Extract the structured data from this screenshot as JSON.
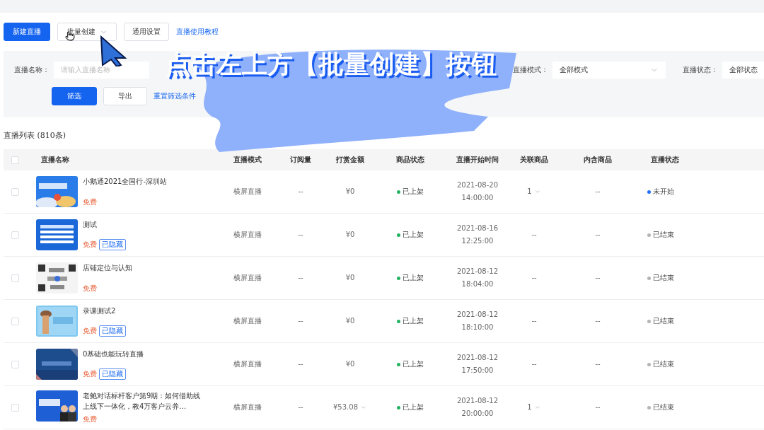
{
  "toolbar": {
    "buttons": [
      {
        "label": "新建直播",
        "kind": "primary"
      },
      {
        "label": "批量创建",
        "kind": "dropdown"
      },
      {
        "label": "通用设置",
        "kind": "default"
      }
    ],
    "link": "直播使用教程"
  },
  "filters": {
    "fields": [
      {
        "label": "直播名称：",
        "placeholder": "请输入直播名称",
        "kind": "input"
      },
      {
        "label": "直播模式：",
        "value": "全部模式",
        "kind": "select"
      },
      {
        "label": "直播状态：",
        "value": "全部状态",
        "kind": "select"
      }
    ],
    "buttons": [
      {
        "label": "筛选",
        "kind": "primary"
      },
      {
        "label": "导出",
        "kind": "default"
      }
    ],
    "reset_link": "重置筛选条件"
  },
  "caption": "点击左上方【批量创建】按钮",
  "list_title": "直播列表 (810条)",
  "table": {
    "select_all_checked": false,
    "columns": [
      "直播名称",
      "直播模式",
      "订阅量",
      "打赏金额",
      "商品状态",
      "直播开始时间",
      "关联商品",
      "内含商品",
      "直播状态"
    ],
    "rows": [
      {
        "checked": false,
        "title": "小鹅通2021全国行-深圳站",
        "price": "免费",
        "mode": "横屏直播",
        "subscribers": "--",
        "reward": "¥0",
        "reward_expandable": false,
        "goods_status": {
          "text": "已上架",
          "color": "#22b35e"
        },
        "date": "2021-08-20",
        "time": "14:00:00",
        "linked": "1",
        "linked_expandable": true,
        "contained": "--",
        "status": {
          "text": "未开始",
          "color": "#1f6fff"
        }
      },
      {
        "checked": false,
        "title": "测试",
        "price": "免费",
        "hidden_tag": "已隐藏",
        "mode": "横屏直播",
        "subscribers": "--",
        "reward": "¥0",
        "reward_expandable": false,
        "goods_status": {
          "text": "已上架",
          "color": "#22b35e"
        },
        "date": "2021-08-16",
        "time": "12:25:00",
        "linked": "--",
        "linked_expandable": false,
        "contained": "--",
        "status": {
          "text": "已结束",
          "color": "#b4b4b4"
        }
      },
      {
        "checked": false,
        "title": "店铺定位与认知",
        "price": "免费",
        "mode": "横屏直播",
        "subscribers": "--",
        "reward": "¥0",
        "reward_expandable": false,
        "goods_status": {
          "text": "已上架",
          "color": "#22b35e"
        },
        "date": "2021-08-12",
        "time": "18:04:00",
        "linked": "--",
        "linked_expandable": false,
        "contained": "--",
        "status": {
          "text": "已结束",
          "color": "#b4b4b4"
        }
      },
      {
        "checked": false,
        "title": "录课测试2",
        "price": "免费",
        "hidden_tag": "已隐藏",
        "mode": "横屏直播",
        "subscribers": "--",
        "reward": "¥0",
        "reward_expandable": false,
        "goods_status": {
          "text": "已上架",
          "color": "#22b35e"
        },
        "date": "2021-08-12",
        "time": "18:10:00",
        "linked": "--",
        "linked_expandable": false,
        "contained": "--",
        "status": {
          "text": "已结束",
          "color": "#b4b4b4"
        }
      },
      {
        "checked": false,
        "title": "0基础也能玩转直播",
        "price": "免费",
        "hidden_tag": "已隐藏",
        "mode": "横屏直播",
        "subscribers": "--",
        "reward": "¥0",
        "reward_expandable": false,
        "goods_status": {
          "text": "已上架",
          "color": "#22b35e"
        },
        "date": "2021-08-12",
        "time": "17:50:00",
        "linked": "--",
        "linked_expandable": false,
        "contained": "--",
        "status": {
          "text": "已结束",
          "color": "#b4b4b4"
        }
      },
      {
        "checked": false,
        "title": "老鲍对话标杆客户第9期：如何借助线上线下一体化，教4万客户云养…",
        "price": "免费",
        "mode": "横屏直播",
        "subscribers": "--",
        "reward": "¥53.08",
        "reward_expandable": true,
        "goods_status": {
          "text": "已上架",
          "color": "#22b35e"
        },
        "date": "2021-08-12",
        "time": "20:00:00",
        "linked": "1",
        "linked_expandable": true,
        "contained": "--",
        "status": {
          "text": "已结束",
          "color": "#b4b4b4"
        }
      }
    ]
  }
}
